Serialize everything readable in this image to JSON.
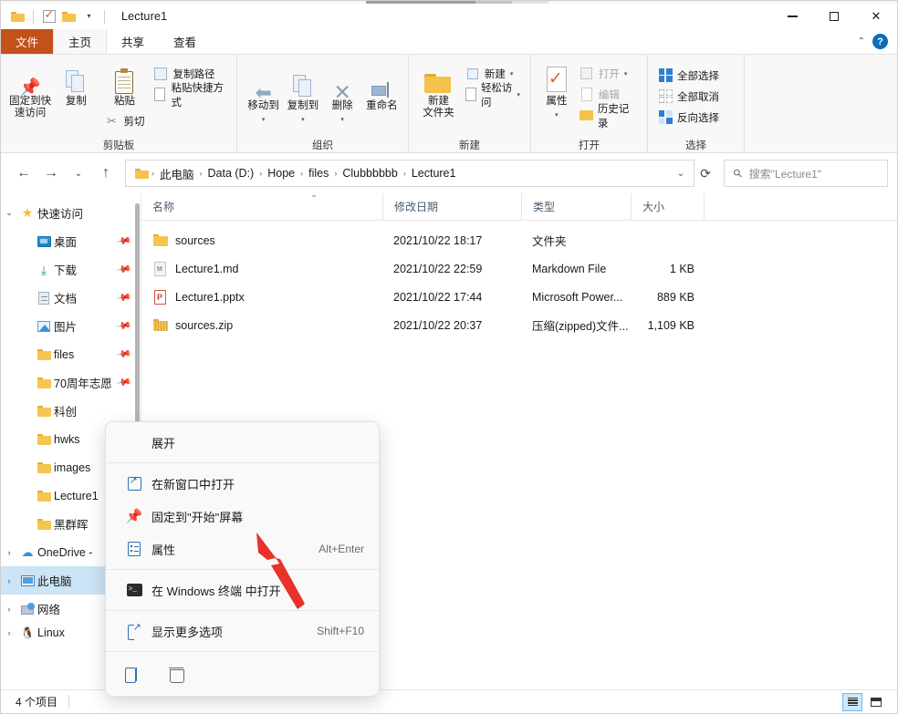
{
  "window": {
    "title": "Lecture1",
    "quick_access_icons": [
      "folder-icon",
      "properties-check-icon",
      "folder-icon",
      "chevron-down-icon"
    ],
    "controls": {
      "minimize": "—",
      "maximize": "□",
      "close": "✕"
    }
  },
  "tabs": [
    {
      "label": "文件",
      "name": "tab-file",
      "style": "file"
    },
    {
      "label": "主页",
      "name": "tab-home",
      "style": "active"
    },
    {
      "label": "共享",
      "name": "tab-share",
      "style": "normal"
    },
    {
      "label": "查看",
      "name": "tab-view",
      "style": "normal"
    }
  ],
  "tabs_right": {
    "collapse": "⌃",
    "help": "?"
  },
  "ribbon": {
    "groups": [
      {
        "label": "剪贴板",
        "big": [
          {
            "label": "固定到快\n速访问",
            "icon": "pin-icon"
          },
          {
            "label": "复制",
            "icon": "copy-icon"
          },
          {
            "label": "粘贴",
            "icon": "paste-icon"
          }
        ],
        "cut_label": "剪切",
        "small": [
          {
            "label": "复制路径",
            "icon": "copy-path-icon"
          },
          {
            "label": "粘贴快捷方式",
            "icon": "paste-shortcut-icon"
          }
        ]
      },
      {
        "label": "组织",
        "big": [
          {
            "label": "移动到",
            "icon": "move-to-icon"
          },
          {
            "label": "复制到",
            "icon": "copy-to-icon"
          },
          {
            "label": "删除",
            "icon": "delete-icon"
          },
          {
            "label": "重命名",
            "icon": "rename-icon"
          }
        ]
      },
      {
        "label": "新建",
        "big": [
          {
            "label": "新建\n文件夹",
            "icon": "new-folder-icon"
          }
        ],
        "small": [
          {
            "label": "新建",
            "icon": "new-item-icon",
            "dropdown": true
          },
          {
            "label": "轻松访问",
            "icon": "easy-access-icon",
            "dropdown": true
          }
        ]
      },
      {
        "label": "打开",
        "big": [
          {
            "label": "属性",
            "icon": "properties-icon"
          }
        ],
        "small": [
          {
            "label": "打开",
            "icon": "open-icon",
            "dropdown": true,
            "disabled": true
          },
          {
            "label": "编辑",
            "icon": "edit-icon",
            "disabled": true
          },
          {
            "label": "历史记录",
            "icon": "history-icon",
            "disabled": false
          }
        ]
      },
      {
        "label": "选择",
        "small": [
          {
            "label": "全部选择",
            "icon": "select-all-icon"
          },
          {
            "label": "全部取消",
            "icon": "select-none-icon"
          },
          {
            "label": "反向选择",
            "icon": "invert-selection-icon"
          }
        ]
      }
    ]
  },
  "address": {
    "back": "←",
    "forward": "→",
    "recent": "⌄",
    "up": "↑",
    "breadcrumbs": [
      "此电脑",
      "Data (D:)",
      "Hope",
      "files",
      "Clubbbbbb",
      "Lecture1"
    ],
    "separator": "›",
    "dropdown": "⌄",
    "refresh": "⟳"
  },
  "search": {
    "placeholder": "搜索\"Lecture1\"",
    "icon": "search-icon"
  },
  "sidebar": {
    "items": [
      {
        "label": "快速访问",
        "icon": "star-icon",
        "expander": "⌄",
        "indent": 0,
        "pin": false,
        "selected": false
      },
      {
        "label": "桌面",
        "icon": "desktop-icon",
        "expander": "",
        "indent": 1,
        "pin": true,
        "selected": false
      },
      {
        "label": "下载",
        "icon": "downloads-icon",
        "expander": "",
        "indent": 1,
        "pin": true,
        "selected": false
      },
      {
        "label": "文档",
        "icon": "documents-icon",
        "expander": "",
        "indent": 1,
        "pin": true,
        "selected": false
      },
      {
        "label": "图片",
        "icon": "pictures-icon",
        "expander": "",
        "indent": 1,
        "pin": true,
        "selected": false
      },
      {
        "label": "files",
        "icon": "folder-icon",
        "expander": "",
        "indent": 1,
        "pin": true,
        "selected": false
      },
      {
        "label": "70周年志愿",
        "icon": "folder-icon",
        "expander": "",
        "indent": 1,
        "pin": true,
        "selected": false
      },
      {
        "label": "科创",
        "icon": "folder-icon",
        "expander": "",
        "indent": 1,
        "pin": false,
        "selected": false
      },
      {
        "label": "hwks",
        "icon": "folder-icon",
        "expander": "",
        "indent": 1,
        "pin": false,
        "selected": false
      },
      {
        "label": "images",
        "icon": "folder-icon",
        "expander": "",
        "indent": 1,
        "pin": false,
        "selected": false
      },
      {
        "label": "Lecture1",
        "icon": "folder-icon",
        "expander": "",
        "indent": 1,
        "pin": false,
        "selected": false
      },
      {
        "label": "黑群晖",
        "icon": "folder-icon",
        "expander": "",
        "indent": 1,
        "pin": false,
        "selected": false
      },
      {
        "label": "OneDrive -",
        "icon": "onedrive-icon",
        "expander": "›",
        "indent": 0,
        "pin": false,
        "selected": false
      },
      {
        "label": "此电脑",
        "icon": "this-pc-icon",
        "expander": "›",
        "indent": 0,
        "pin": false,
        "selected": true
      },
      {
        "label": "网络",
        "icon": "network-icon",
        "expander": "›",
        "indent": 0,
        "pin": false,
        "selected": false
      },
      {
        "label": "Linux",
        "icon": "linux-icon",
        "expander": "›",
        "indent": 0,
        "pin": false,
        "selected": false
      }
    ]
  },
  "filelist": {
    "columns": [
      {
        "label": "名称",
        "key": "name"
      },
      {
        "label": "修改日期",
        "key": "date"
      },
      {
        "label": "类型",
        "key": "type"
      },
      {
        "label": "大小",
        "key": "size"
      }
    ],
    "sort_indicator": "⌃",
    "rows": [
      {
        "name": "sources",
        "date": "2021/10/22 18:17",
        "type": "文件夹",
        "size": "",
        "icon": "folder-icon"
      },
      {
        "name": "Lecture1.md",
        "date": "2021/10/22 22:59",
        "type": "Markdown File",
        "size": "1 KB",
        "icon": "markdown-file-icon"
      },
      {
        "name": "Lecture1.pptx",
        "date": "2021/10/22 17:44",
        "type": "Microsoft Power...",
        "size": "889 KB",
        "icon": "powerpoint-file-icon"
      },
      {
        "name": "sources.zip",
        "date": "2021/10/22 20:37",
        "type": "压缩(zipped)文件...",
        "size": "1,109 KB",
        "icon": "zip-file-icon"
      }
    ]
  },
  "context_menu": {
    "header": {
      "label": "展开",
      "name": "ctx-expand"
    },
    "items": [
      {
        "label": "在新窗口中打开",
        "accel": "",
        "icon": "open-new-window-icon"
      },
      {
        "label": "固定到\"开始\"屏幕",
        "accel": "",
        "icon": "pin-to-start-icon"
      },
      {
        "label": "属性",
        "accel": "Alt+Enter",
        "icon": "properties-icon"
      },
      {
        "label": "在 Windows 终端 中打开",
        "accel": "",
        "icon": "terminal-icon"
      },
      {
        "label": "显示更多选项",
        "accel": "Shift+F10",
        "icon": "show-more-options-icon"
      }
    ],
    "icon_row": [
      {
        "icon": "rename-icon",
        "name": "ctx-rename-button"
      },
      {
        "icon": "delete-trash-icon",
        "name": "ctx-delete-button"
      }
    ]
  },
  "annotation": {
    "arrow_color": "#e8322a",
    "shape": "arrow-pointer"
  },
  "statusbar": {
    "item_count": "4 个项目",
    "views": [
      {
        "icon": "details-view-icon",
        "active": true
      },
      {
        "icon": "large-icons-view-icon",
        "active": false
      }
    ]
  },
  "colors": {
    "file_tab": "#c4501a",
    "selection": "#cce4f7",
    "accent": "#0f6cbd",
    "folder": "#f5c64d",
    "annotation_red": "#e8322a"
  }
}
